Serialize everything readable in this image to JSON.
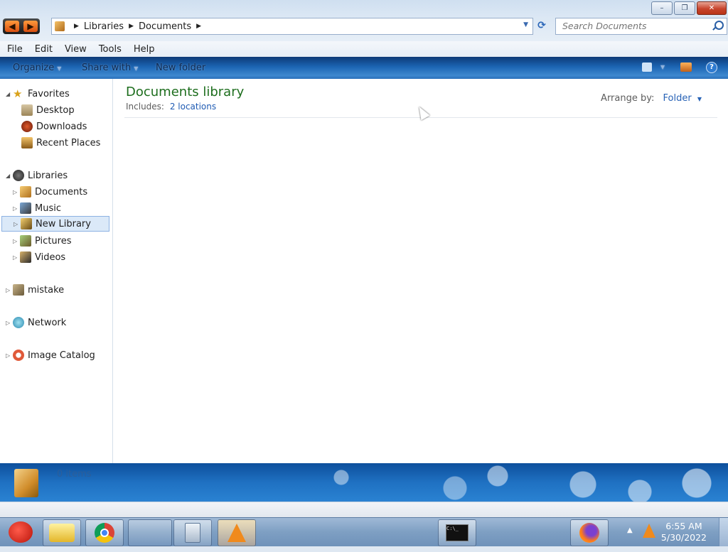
{
  "window": {
    "controls": {
      "minimize": "–",
      "maximize": "❐",
      "close": "✕"
    }
  },
  "address_bar": {
    "crumbs": [
      "Libraries",
      "Documents"
    ]
  },
  "search": {
    "placeholder": "Search Documents"
  },
  "menu": [
    "File",
    "Edit",
    "View",
    "Tools",
    "Help"
  ],
  "command_bar": {
    "organize": "Organize",
    "share_with": "Share with",
    "new_folder": "New folder"
  },
  "nav_pane": {
    "favorites": {
      "label": "Favorites",
      "items": [
        "Desktop",
        "Downloads",
        "Recent Places"
      ]
    },
    "libraries": {
      "label": "Libraries",
      "items": [
        "Documents",
        "Music",
        "New Library",
        "Pictures",
        "Videos"
      ],
      "selected": "New Library"
    },
    "other": [
      "mistake",
      "Network",
      "Image Catalog"
    ]
  },
  "content": {
    "title": "Documents library",
    "includes_label": "Includes:",
    "includes_link": "2 locations",
    "arrange_label": "Arrange by:",
    "arrange_value": "Folder"
  },
  "details": {
    "item_count": "0 items"
  },
  "taskbar": {
    "time": "6:55 AM",
    "date": "5/30/2022"
  },
  "colors": {
    "library_title": "#1e6e1e",
    "link": "#1f5bb3",
    "command_bar": "#1c65b3"
  }
}
